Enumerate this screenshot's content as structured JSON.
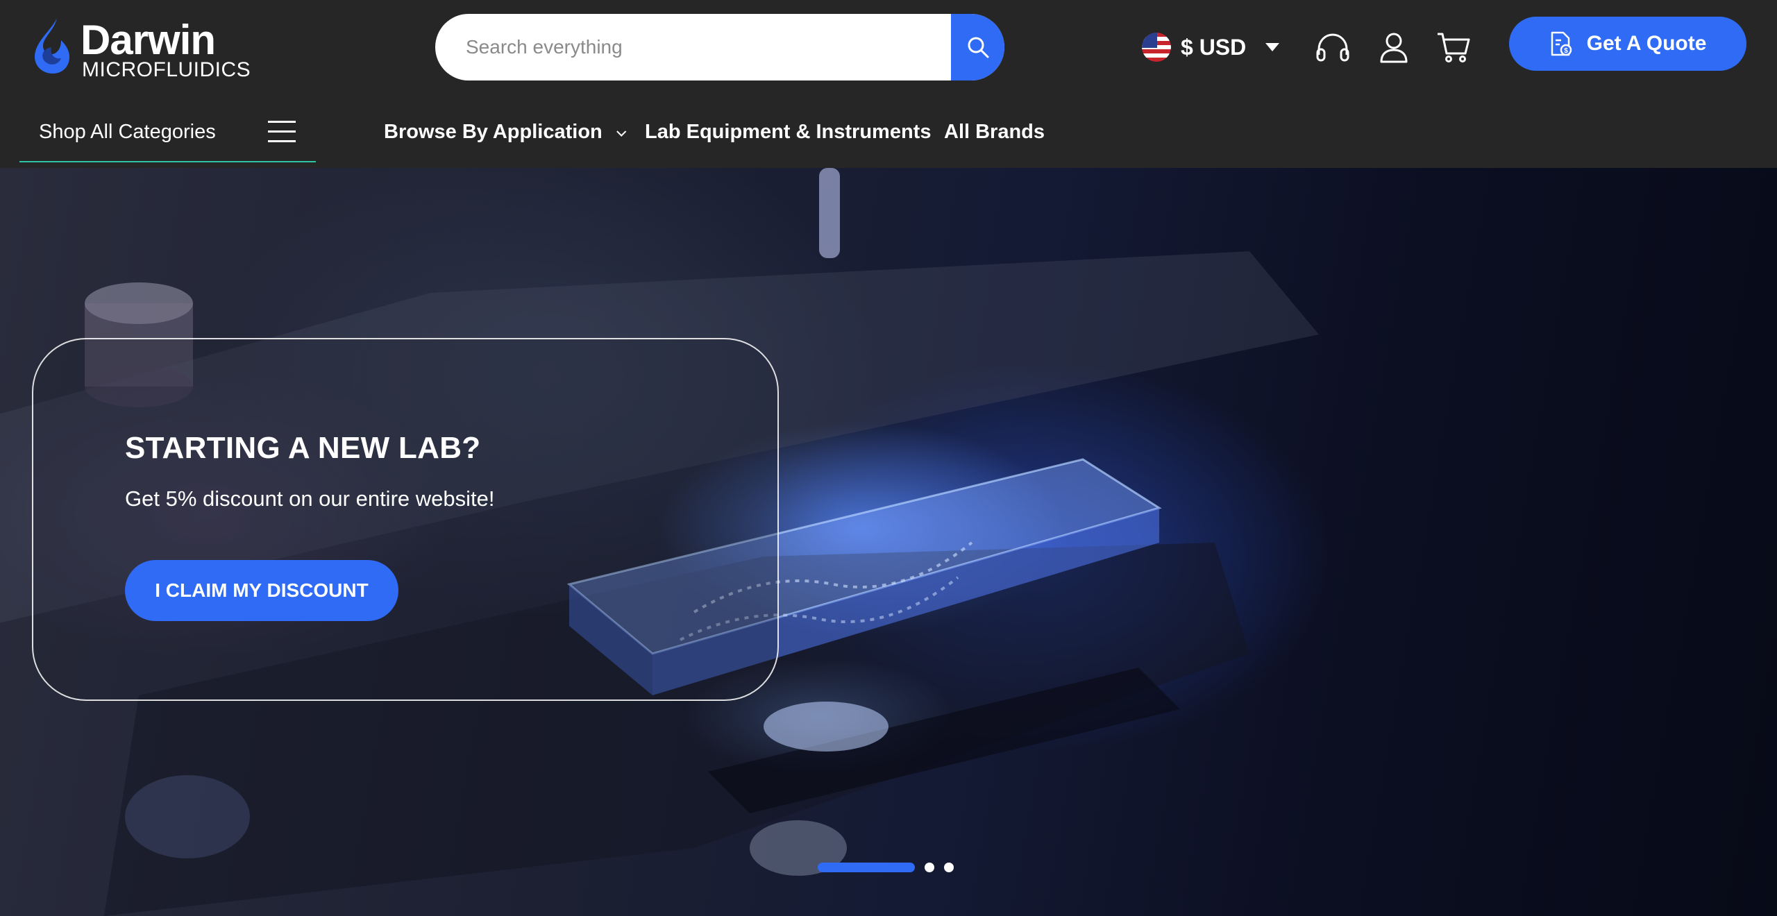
{
  "brand": {
    "name": "Darwin",
    "tagline": "MICROFLUIDICS"
  },
  "search": {
    "placeholder": "Search everything",
    "value": ""
  },
  "currency": {
    "label": "$ USD",
    "flag": "us-flag-icon"
  },
  "header_icons": [
    "headset-icon",
    "user-icon",
    "cart-icon"
  ],
  "quote_button": {
    "label": "Get A Quote",
    "icon": "quote-document-icon"
  },
  "nav": {
    "shop_all": "Shop All Categories",
    "items": [
      {
        "label": "Browse By Application",
        "has_dropdown": true
      },
      {
        "label": "Lab Equipment & Instruments",
        "has_dropdown": false
      },
      {
        "label": "All Brands",
        "has_dropdown": false
      }
    ]
  },
  "hero": {
    "title": "STARTING A NEW LAB?",
    "subtitle": "Get 5% discount on our entire website!",
    "cta": "I CLAIM MY DISCOUNT",
    "slides": 3,
    "active_slide": 1
  },
  "colors": {
    "accent": "#2f6bf5",
    "header_bg": "#262626",
    "nav_underline": "#2fc4a4"
  }
}
